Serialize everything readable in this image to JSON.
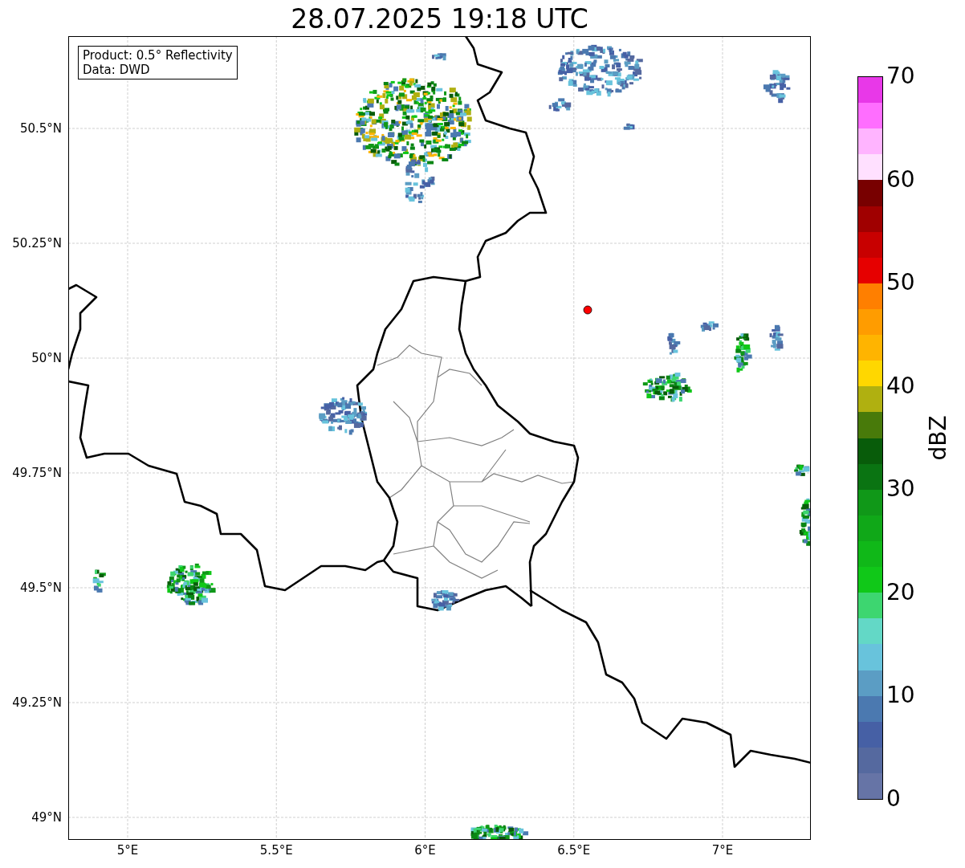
{
  "title": "28.07.2025 19:18 UTC",
  "info": [
    "Product: 0.5° Reflectivity",
    "Data: DWD"
  ],
  "lat_ticks": [
    "50.5°N",
    "50.25°N",
    "50°N",
    "49.75°N",
    "49.5°N",
    "49.25°N",
    "49°N"
  ],
  "lon_ticks": [
    "5°E",
    "5.5°E",
    "6°E",
    "6.5°E",
    "7°E"
  ],
  "colorbar": {
    "label": "dBZ",
    "ticks": [
      "70",
      "60",
      "50",
      "40",
      "30",
      "20",
      "10",
      "0"
    ],
    "bins": [
      {
        "color": "#e838e8"
      },
      {
        "color": "#ff6eff"
      },
      {
        "color": "#ffb4ff"
      },
      {
        "color": "#ffe0ff"
      },
      {
        "color": "#780000"
      },
      {
        "color": "#a00000"
      },
      {
        "color": "#c80000"
      },
      {
        "color": "#e60000"
      },
      {
        "color": "#ff7f00"
      },
      {
        "color": "#ff9c00"
      },
      {
        "color": "#ffb400"
      },
      {
        "color": "#ffd700"
      },
      {
        "color": "#b0b010"
      },
      {
        "color": "#487a0a"
      },
      {
        "color": "#085c0a"
      },
      {
        "color": "#0a7412"
      },
      {
        "color": "#109818"
      },
      {
        "color": "#10a818"
      },
      {
        "color": "#10b818"
      },
      {
        "color": "#10c818"
      },
      {
        "color": "#3dd670"
      },
      {
        "color": "#63d8c6"
      },
      {
        "color": "#68c3dc"
      },
      {
        "color": "#5b9dc4"
      },
      {
        "color": "#4b79b0"
      },
      {
        "color": "#4660a5"
      },
      {
        "color": "#55699f"
      },
      {
        "color": "#6674a6"
      }
    ]
  }
}
